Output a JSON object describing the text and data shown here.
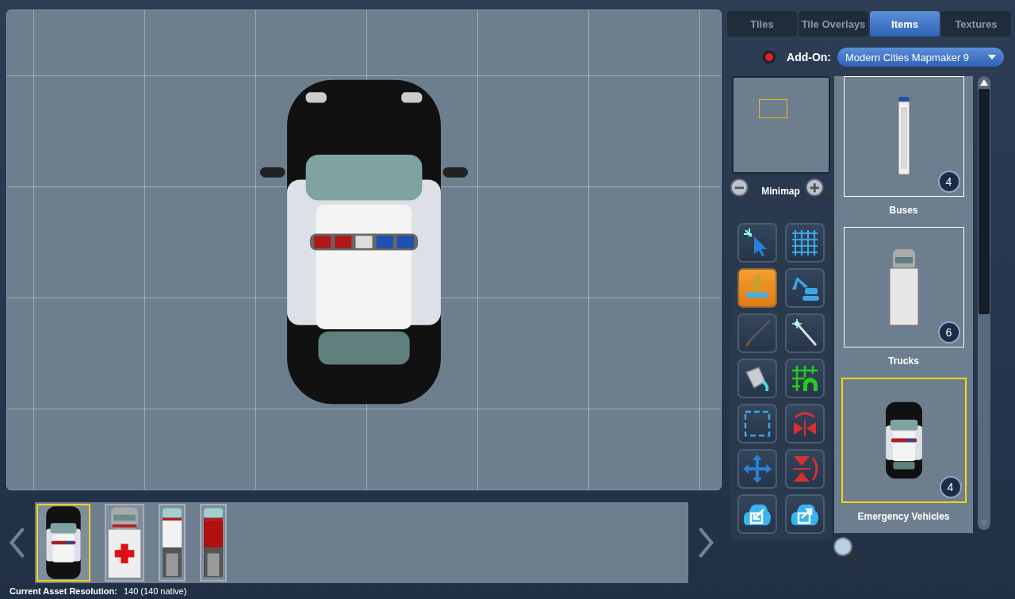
{
  "tabs": [
    {
      "label": "Tiles",
      "selected": false
    },
    {
      "label": "Tile Overlays",
      "selected": false
    },
    {
      "label": "Items",
      "selected": true
    },
    {
      "label": "Textures",
      "selected": false
    }
  ],
  "addon": {
    "label": "Add-On:",
    "value": "Modern Cities Mapmaker 9"
  },
  "minimap": {
    "label": "Minimap"
  },
  "tools": [
    {
      "kind": "select",
      "selected": false
    },
    {
      "kind": "grid",
      "selected": false
    },
    {
      "kind": "stamp",
      "selected": true
    },
    {
      "kind": "excavator",
      "selected": false
    },
    {
      "kind": "brush",
      "selected": false
    },
    {
      "kind": "wand",
      "selected": false
    },
    {
      "kind": "bucket",
      "selected": false
    },
    {
      "kind": "grid-arch",
      "selected": false
    },
    {
      "kind": "marquee",
      "selected": false
    },
    {
      "kind": "flip-h",
      "selected": false
    },
    {
      "kind": "move",
      "selected": false
    },
    {
      "kind": "flip-v",
      "selected": false
    },
    {
      "kind": "cloud-import",
      "selected": false
    },
    {
      "kind": "cloud-export",
      "selected": false
    }
  ],
  "categories": [
    {
      "name": "Buses",
      "count": "4",
      "kind": "bus",
      "selected": false
    },
    {
      "name": "Trucks",
      "count": "6",
      "kind": "truck",
      "selected": false
    },
    {
      "name": "Emergency Vehicles",
      "count": "4",
      "kind": "police",
      "selected": true
    }
  ],
  "strip": [
    {
      "kind": "police",
      "selected": true
    },
    {
      "kind": "ambulance",
      "selected": false
    },
    {
      "kind": "fire-white",
      "selected": false
    },
    {
      "kind": "fire-red",
      "selected": false
    }
  ],
  "canvas": {
    "kind": "police"
  },
  "status": {
    "label": "Current Asset Resolution:",
    "value": "140 (140 native)"
  }
}
